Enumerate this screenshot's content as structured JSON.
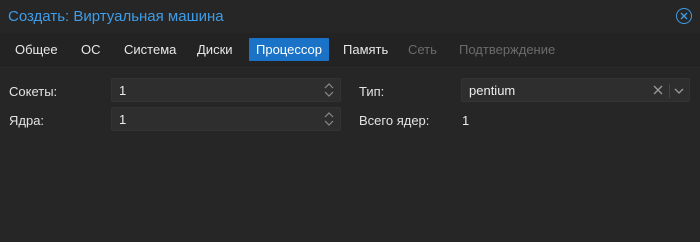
{
  "window": {
    "title": "Создать: Виртуальная машина"
  },
  "tabs": [
    {
      "label": "Общее",
      "state": "normal"
    },
    {
      "label": "ОС",
      "state": "normal"
    },
    {
      "label": "Система",
      "state": "normal"
    },
    {
      "label": "Диски",
      "state": "normal"
    },
    {
      "label": "Процессор",
      "state": "active"
    },
    {
      "label": "Память",
      "state": "normal"
    },
    {
      "label": "Сеть",
      "state": "disabled"
    },
    {
      "label": "Подтверждение",
      "state": "disabled"
    }
  ],
  "form": {
    "sockets": {
      "label": "Сокеты:",
      "value": "1"
    },
    "cores": {
      "label": "Ядра:",
      "value": "1"
    },
    "type": {
      "label": "Тип:",
      "value": "pentium"
    },
    "total_cores": {
      "label": "Всего ядер:",
      "value": "1"
    }
  },
  "icons": {
    "close": "close-circle-icon",
    "spinner": "spinner-updown-icon",
    "clear": "clear-x-icon",
    "dropdown": "chevron-down-icon"
  },
  "colors": {
    "accent": "#1a73c7",
    "title": "#3f9ce8",
    "background": "#232323"
  }
}
